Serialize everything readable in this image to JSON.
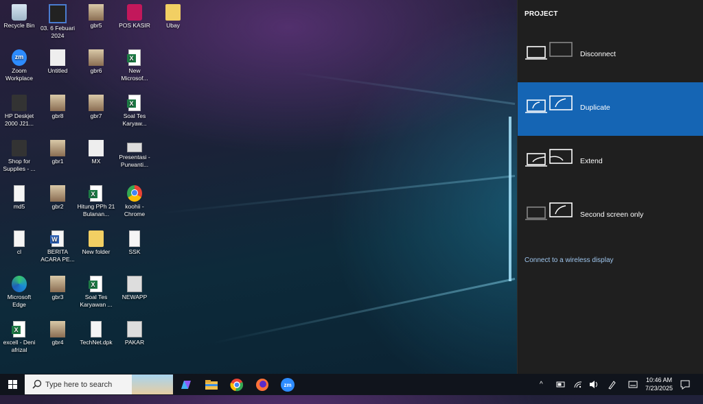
{
  "desktop": {
    "icons": [
      {
        "label": "Recycle Bin"
      },
      {
        "label": "03. 6 Febuari 2024"
      },
      {
        "label": "gbr5"
      },
      {
        "label": "POS KASIR"
      },
      {
        "label": "Ubay"
      },
      {
        "label": "Zoom Workplace"
      },
      {
        "label": "Untitled"
      },
      {
        "label": "gbr6"
      },
      {
        "label": "New Microsof..."
      },
      {
        "label": "HP Deskjet 2000 J21..."
      },
      {
        "label": "gbr8"
      },
      {
        "label": "gbr7"
      },
      {
        "label": "Soal Tes Karyaw..."
      },
      {
        "label": "Shop for Supplies - ..."
      },
      {
        "label": "gbr1"
      },
      {
        "label": "MX"
      },
      {
        "label": "Presentasi - Purwanti..."
      },
      {
        "label": "md5"
      },
      {
        "label": "gbr2"
      },
      {
        "label": "Hitung PPh 21 Bulanan..."
      },
      {
        "label": "koohii - Chrome"
      },
      {
        "label": "cl"
      },
      {
        "label": "BERITA ACARA PE..."
      },
      {
        "label": "New folder"
      },
      {
        "label": "SSK"
      },
      {
        "label": "Microsoft Edge"
      },
      {
        "label": "gbr3"
      },
      {
        "label": "Soal Tes Karyawan ..."
      },
      {
        "label": "NEWAPP"
      },
      {
        "label": "excell - Deni afrizal"
      },
      {
        "label": "gbr4"
      },
      {
        "label": "TechNet.dpk"
      },
      {
        "label": "PAKAR"
      }
    ]
  },
  "project_panel": {
    "title": "PROJECT",
    "options": [
      {
        "label": "Disconnect",
        "selected": false
      },
      {
        "label": "Duplicate",
        "selected": true
      },
      {
        "label": "Extend",
        "selected": false
      },
      {
        "label": "Second screen only",
        "selected": false
      }
    ],
    "wireless_link": "Connect to a wireless display",
    "selected_color": "#1565b4"
  },
  "taskbar": {
    "search_placeholder": "Type here to search",
    "apps": [
      "copilot-icon",
      "file-explorer-icon",
      "chrome-icon",
      "firefox-icon",
      "zoom-icon"
    ],
    "time": "10:46 AM",
    "date": "7/23/2025"
  }
}
